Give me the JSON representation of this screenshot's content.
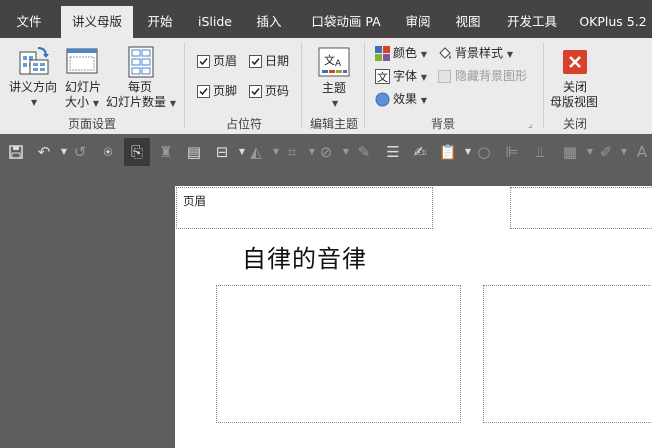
{
  "menu": {
    "tabs": [
      {
        "label": "文件",
        "active": false
      },
      {
        "label": "讲义母版",
        "active": true
      },
      {
        "label": "开始",
        "active": false
      },
      {
        "label": "iSlide",
        "active": false
      },
      {
        "label": "插入",
        "active": false
      },
      {
        "label": "口袋动画 PA",
        "active": false
      },
      {
        "label": "审阅",
        "active": false
      },
      {
        "label": "视图",
        "active": false
      },
      {
        "label": "开发工具",
        "active": false
      },
      {
        "label": "OKPlus 5.2",
        "active": false
      }
    ]
  },
  "ribbon": {
    "page_setup": {
      "title": "页面设置",
      "orientation_label_1": "讲义方向",
      "slide_size_label_1": "幻灯片",
      "slide_size_label_2": "大小",
      "per_page_label_1": "每页",
      "per_page_label_2": "幻灯片数量"
    },
    "placeholders": {
      "title": "占位符",
      "header": "页眉",
      "header_checked": true,
      "date": "日期",
      "date_checked": true,
      "footer": "页脚",
      "footer_checked": true,
      "page_number": "页码",
      "page_number_checked": true
    },
    "edit_theme": {
      "title": "编辑主题",
      "theme_label": "主题"
    },
    "background": {
      "title": "背景",
      "colors": "颜色",
      "fonts": "字体",
      "effects": "效果",
      "bg_styles": "背景样式",
      "hide_bg": "隐藏背景图形",
      "hide_bg_checked": false
    },
    "close": {
      "title": "关闭",
      "close_label_1": "关闭",
      "close_label_2": "母版视图"
    }
  },
  "slide": {
    "header_text": "页眉",
    "title_text": "自律的音律"
  },
  "colors": {
    "menubar": "#444444",
    "ribbon": "#ebebeb",
    "close_red": "#d9412b",
    "canvas": "#5e5e5e"
  }
}
